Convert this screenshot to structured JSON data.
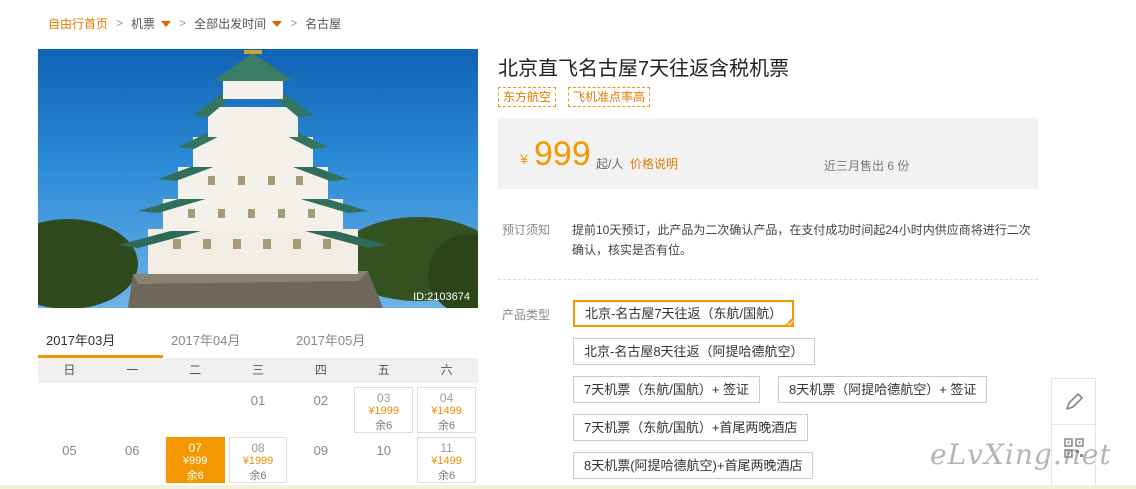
{
  "breadcrumb": {
    "home": "自由行首页",
    "item1": "机票",
    "item2": "全部出发时间",
    "item3": "名古屋",
    "sep": ">"
  },
  "hero": {
    "image_id": "ID:2103674"
  },
  "months": [
    "2017年03月",
    "2017年04月",
    "2017年05月"
  ],
  "weekdays": [
    "日",
    "一",
    "二",
    "三",
    "四",
    "五",
    "六"
  ],
  "calendar": {
    "row1": {
      "d3": "01",
      "d4": "02",
      "d5": {
        "num": "03",
        "price": "¥1999",
        "remain": "余6"
      },
      "d6": {
        "num": "04",
        "price": "¥1499",
        "remain": "余6"
      }
    },
    "row2": {
      "d0": "05",
      "d1": "06",
      "d2": {
        "num": "07",
        "price": "¥999",
        "remain": "余6"
      },
      "d3": {
        "num": "08",
        "price": "¥1999",
        "remain": "余6"
      },
      "d4": "09",
      "d5": "10",
      "d6": {
        "num": "11",
        "price": "¥1499",
        "remain": "余6"
      }
    }
  },
  "product": {
    "title": "北京直飞名古屋7天往返含税机票",
    "tags": [
      "东方航空",
      "飞机准点率高"
    ],
    "yen": "¥",
    "price": "999",
    "unit": "起/人",
    "price_explain": "价格说明",
    "sold": "近三月售出 6 份",
    "notice_label": "预订须知",
    "notice_text": "提前10天预订，此产品为二次确认产品，在支付成功时间起24小时内供应商将进行二次确认，核实是否有位。",
    "type_label": "产品类型",
    "options": [
      "北京-名古屋7天往返（东航/国航）",
      "北京-名古屋8天往返（阿提哈德航空）",
      "7天机票（东航/国航）+ 签证",
      "8天机票（阿提哈德航空）+ 签证",
      "7天机票（东航/国航）+首尾两晚酒店",
      "8天机票(阿提哈德航空)+首尾两晚酒店"
    ]
  },
  "watermark": "eLvXing.net",
  "colors": {
    "accent": "#f39800",
    "link": "#e07b00"
  }
}
